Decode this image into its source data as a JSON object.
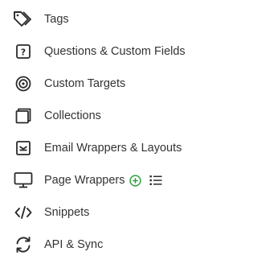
{
  "nav": {
    "items": [
      {
        "id": "tags",
        "label": "Tags",
        "icon": "tag-icon"
      },
      {
        "id": "questions",
        "label": "Questions & Custom Fields",
        "icon": "question-box-icon"
      },
      {
        "id": "targets",
        "label": "Custom Targets",
        "icon": "target-icon"
      },
      {
        "id": "collections",
        "label": "Collections",
        "icon": "collections-icon"
      },
      {
        "id": "email-wrappers",
        "label": "Email Wrappers & Layouts",
        "icon": "email-wrapper-icon"
      },
      {
        "id": "page-wrappers",
        "label": "Page Wrappers",
        "icon": "monitor-icon"
      },
      {
        "id": "snippets",
        "label": "Snippets",
        "icon": "code-icon"
      },
      {
        "id": "api-sync",
        "label": "API & Sync",
        "icon": "sync-icon"
      }
    ],
    "page_wrapper_actions": {
      "add_icon": "plus-circle-icon",
      "list_icon": "list-icon",
      "accent_color": "#2e9e3e"
    }
  }
}
